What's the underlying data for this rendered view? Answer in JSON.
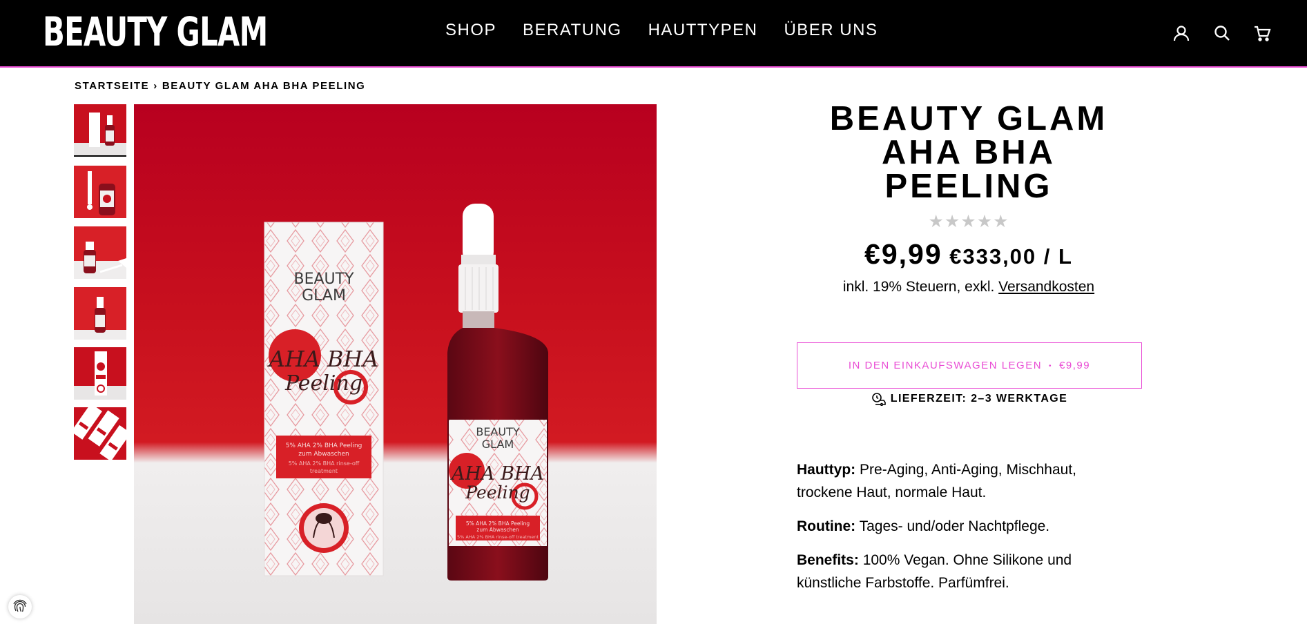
{
  "header": {
    "logo": "BEAUTY GLAM",
    "nav": [
      "SHOP",
      "BERATUNG",
      "HAUTTYPEN",
      "ÜBER UNS"
    ],
    "icons": [
      "account-icon",
      "search-icon",
      "cart-icon"
    ]
  },
  "breadcrumb": {
    "home": "STARTSEITE",
    "separator": "›",
    "current": "BEAUTY GLAM AHA BHA PEELING"
  },
  "gallery": {
    "thumbnail_count": 6,
    "active_index": 0,
    "box_text": {
      "brand_line1": "BEAUTY",
      "brand_line2": "GLAM",
      "script_line1": "AHA BHA",
      "script_line2": "Peeling",
      "box_label_line1": "5% AHA 2% BHA Peeling",
      "box_label_line2": "zum Abwaschen",
      "box_label_line3": "5% AHA 2% BHA rinse-off",
      "box_label_line4": "treatment",
      "bottle_label_line1": "5% AHA 2% BHA Peeling",
      "bottle_label_line2": "zum Abwaschen",
      "bottle_label_line3": "5% AHA 2% BHA rinse-off treatment"
    }
  },
  "product": {
    "title_lines": [
      "BEAUTY GLAM",
      "AHA BHA",
      "PEELING"
    ],
    "stars": "★★★★★",
    "rating": 0,
    "price": "€9,99",
    "unit_price": "€333,00 / L",
    "tax_text": "inkl. 19% Steuern, exkl.",
    "shipping_link": "Versandkosten",
    "add_to_cart_label": "IN DEN EINKAUFSWAGEN LEGEN",
    "add_to_cart_separator": "•",
    "add_to_cart_price": "€9,99",
    "delivery": "LIEFERZEIT: 2–3 WERKTAGE"
  },
  "details": [
    {
      "label": "Hauttyp:",
      "text": "Pre-Aging, Anti-Aging, Mischhaut, trockene Haut, normale Haut."
    },
    {
      "label": "Routine:",
      "text": "Tages- und/oder Nachtpflege."
    },
    {
      "label": "Benefits:",
      "text": "100% Vegan. Ohne Silikone und künstliche Farbstoffe. Parfümfrei."
    }
  ],
  "colors": {
    "header_bg": "#000000",
    "accent": "#e94bd4",
    "product_red": "#d82027"
  }
}
